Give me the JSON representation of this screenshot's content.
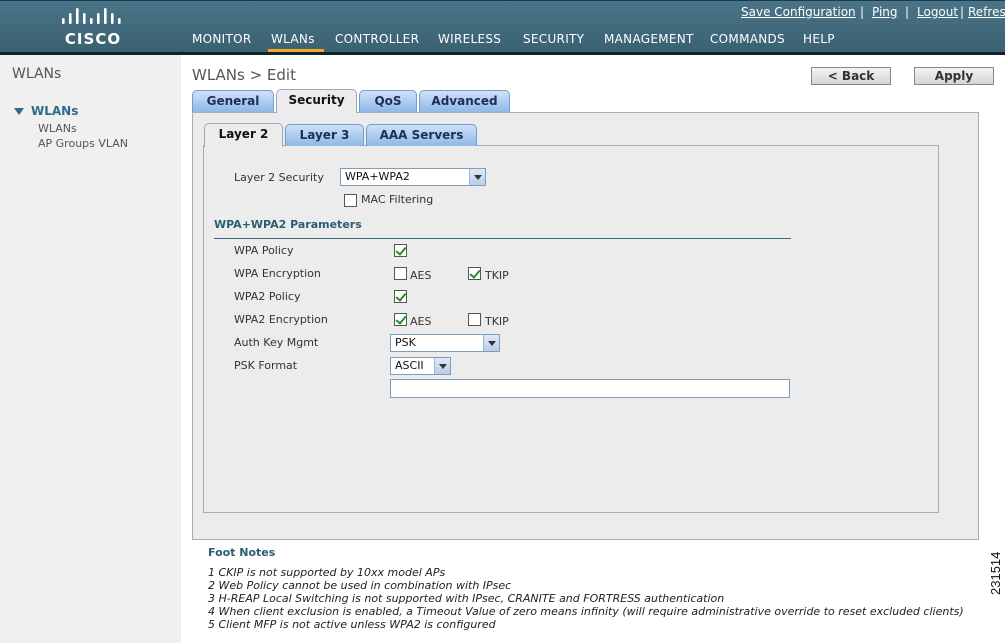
{
  "header": {
    "logo_text": "CISCO",
    "links": [
      "Save Configuration",
      "Ping",
      "Logout",
      "Refresh"
    ],
    "nav": [
      "MONITOR",
      "WLANs",
      "CONTROLLER",
      "WIRELESS",
      "SECURITY",
      "MANAGEMENT",
      "COMMANDS",
      "HELP"
    ],
    "active_nav": "WLANs",
    "accent_color": "#f5a623"
  },
  "sidebar": {
    "title": "WLANs",
    "group": "WLANs",
    "items": [
      "WLANs",
      "AP Groups VLAN"
    ]
  },
  "main": {
    "title": "WLANs > Edit",
    "back_button": "< Back",
    "apply_button": "Apply",
    "tabs": [
      "General",
      "Security",
      "QoS",
      "Advanced"
    ],
    "active_tab": "Security",
    "subtabs": [
      "Layer 2",
      "Layer 3",
      "AAA Servers"
    ],
    "active_subtab": "Layer 2",
    "layer2_security_label": "Layer 2 Security",
    "layer2_security_value": "WPA+WPA2",
    "mac_filtering_label": "MAC Filtering",
    "mac_filtering_checked": false,
    "params_heading": "WPA+WPA2 Parameters",
    "wpa_policy_label": "WPA Policy",
    "wpa_policy_checked": true,
    "wpa_encryption_label": "WPA Encryption",
    "wpa_aes_label": "AES",
    "wpa_aes_checked": false,
    "wpa_tkip_label": "TKIP",
    "wpa_tkip_checked": true,
    "wpa2_policy_label": "WPA2 Policy",
    "wpa2_policy_checked": true,
    "wpa2_encryption_label": "WPA2 Encryption",
    "wpa2_aes_label": "AES",
    "wpa2_aes_checked": true,
    "wpa2_tkip_label": "TKIP",
    "wpa2_tkip_checked": false,
    "auth_key_label": "Auth Key Mgmt",
    "auth_key_value": "PSK",
    "psk_format_label": "PSK Format",
    "psk_format_value": "ASCII",
    "psk_value": ""
  },
  "footnotes": {
    "heading": "Foot Notes",
    "notes": [
      "1 CKIP is not supported by 10xx model APs",
      "2 Web Policy cannot be used in combination with IPsec",
      "3 H-REAP Local Switching is not supported with IPsec, CRANITE and FORTRESS authentication",
      "4 When client exclusion is enabled, a Timeout Value of zero means infinity (will require administrative override to reset excluded clients)",
      "5 Client MFP is not active unless WPA2 is configured"
    ]
  },
  "figure_number": "231514"
}
